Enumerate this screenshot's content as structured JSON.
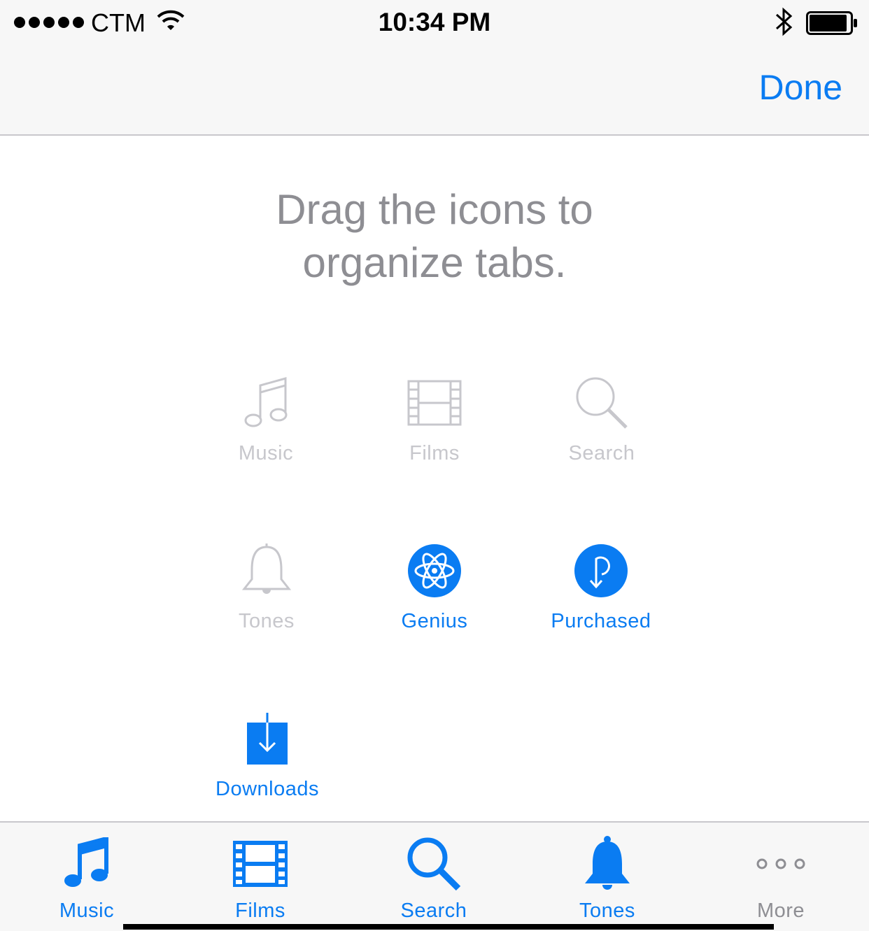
{
  "status_bar": {
    "carrier": "CTM",
    "time": "10:34 PM",
    "signal_icon": "signal-dots-icon",
    "wifi_icon": "wifi-icon",
    "bluetooth_icon": "bluetooth-icon",
    "battery_icon": "battery-icon"
  },
  "nav": {
    "done_label": "Done"
  },
  "instruction": {
    "line1": "Drag the icons to",
    "line2": "organize tabs."
  },
  "grid": {
    "items": [
      {
        "label": "Music",
        "icon": "music-note-icon",
        "state": "disabled"
      },
      {
        "label": "Films",
        "icon": "film-strip-icon",
        "state": "disabled"
      },
      {
        "label": "Search",
        "icon": "magnifier-icon",
        "state": "disabled"
      },
      {
        "label": "Tones",
        "icon": "bell-icon",
        "state": "disabled"
      },
      {
        "label": "Genius",
        "icon": "atom-icon",
        "state": "enabled"
      },
      {
        "label": "Purchased",
        "icon": "purchased-icon",
        "state": "enabled"
      },
      {
        "label": "Downloads",
        "icon": "download-icon",
        "state": "enabled"
      }
    ]
  },
  "tab_bar": {
    "tabs": [
      {
        "label": "Music",
        "icon": "music-note-icon"
      },
      {
        "label": "Films",
        "icon": "film-strip-icon"
      },
      {
        "label": "Search",
        "icon": "magnifier-icon"
      },
      {
        "label": "Tones",
        "icon": "bell-icon"
      },
      {
        "label": "More",
        "icon": "more-dots-icon"
      }
    ]
  },
  "colors": {
    "accent": "#0a7cf2",
    "disabled": "#c7c7cc",
    "secondary_text": "#8e8e93",
    "bar_background": "#f7f7f7"
  }
}
